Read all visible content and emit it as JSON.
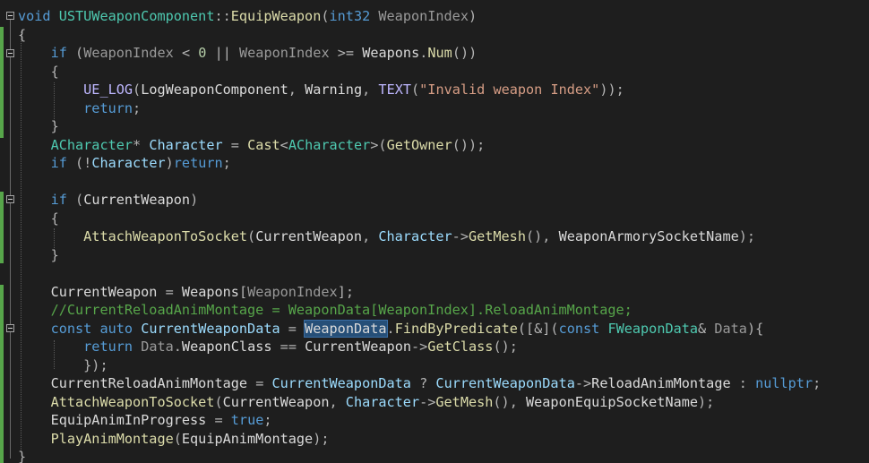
{
  "colors": {
    "background": "#1e1e1e",
    "keyword": "#569cd6",
    "type": "#4ec9b0",
    "function": "#dcdcaa",
    "macro": "#beb7ff",
    "string": "#d69d85",
    "comment": "#57a64a",
    "number": "#b5cea8",
    "parameter": "#9a9a9a",
    "local": "#9cdcfe",
    "change_bar": "#57a64a",
    "selection": "#264f78"
  },
  "editor": {
    "language": "C++",
    "fold_markers": [
      "line-1",
      "line-3",
      "line-11",
      "line-18"
    ],
    "highlighted_word": "WeaponData",
    "lines": [
      {
        "tokens": [
          {
            "k": "keyword",
            "t": "void"
          },
          {
            "k": "plain",
            "t": " "
          },
          {
            "k": "type",
            "t": "USTUWeaponComponent"
          },
          {
            "k": "op",
            "t": "::"
          },
          {
            "k": "func",
            "t": "EquipWeapon"
          },
          {
            "k": "op",
            "t": "("
          },
          {
            "k": "keyword",
            "t": "int32"
          },
          {
            "k": "plain",
            "t": " "
          },
          {
            "k": "param",
            "t": "WeaponIndex"
          },
          {
            "k": "op",
            "t": ")"
          }
        ]
      },
      {
        "tokens": [
          {
            "k": "op",
            "t": "{"
          }
        ]
      },
      {
        "tokens": [
          {
            "k": "plain",
            "t": "    "
          },
          {
            "k": "keyword",
            "t": "if"
          },
          {
            "k": "plain",
            "t": " "
          },
          {
            "k": "op",
            "t": "("
          },
          {
            "k": "param",
            "t": "WeaponIndex"
          },
          {
            "k": "plain",
            "t": " "
          },
          {
            "k": "op",
            "t": "<"
          },
          {
            "k": "plain",
            "t": " "
          },
          {
            "k": "number",
            "t": "0"
          },
          {
            "k": "plain",
            "t": " "
          },
          {
            "k": "op",
            "t": "||"
          },
          {
            "k": "plain",
            "t": " "
          },
          {
            "k": "param",
            "t": "WeaponIndex"
          },
          {
            "k": "plain",
            "t": " "
          },
          {
            "k": "op",
            "t": ">="
          },
          {
            "k": "plain",
            "t": " "
          },
          {
            "k": "member",
            "t": "Weapons"
          },
          {
            "k": "op",
            "t": "."
          },
          {
            "k": "func",
            "t": "Num"
          },
          {
            "k": "op",
            "t": "())"
          }
        ]
      },
      {
        "tokens": [
          {
            "k": "plain",
            "t": "    "
          },
          {
            "k": "op",
            "t": "{"
          }
        ]
      },
      {
        "tokens": [
          {
            "k": "plain",
            "t": "        "
          },
          {
            "k": "macro",
            "t": "UE_LOG"
          },
          {
            "k": "op",
            "t": "("
          },
          {
            "k": "plain",
            "t": "LogWeaponComponent"
          },
          {
            "k": "op",
            "t": ","
          },
          {
            "k": "plain",
            "t": " "
          },
          {
            "k": "plain",
            "t": "Warning"
          },
          {
            "k": "op",
            "t": ","
          },
          {
            "k": "plain",
            "t": " "
          },
          {
            "k": "macro",
            "t": "TEXT"
          },
          {
            "k": "op",
            "t": "("
          },
          {
            "k": "string",
            "t": "\"Invalid weapon Index\""
          },
          {
            "k": "op",
            "t": "));"
          }
        ]
      },
      {
        "tokens": [
          {
            "k": "plain",
            "t": "        "
          },
          {
            "k": "keyword",
            "t": "return"
          },
          {
            "k": "op",
            "t": ";"
          }
        ]
      },
      {
        "tokens": [
          {
            "k": "plain",
            "t": "    "
          },
          {
            "k": "op",
            "t": "}"
          }
        ]
      },
      {
        "tokens": [
          {
            "k": "plain",
            "t": "    "
          },
          {
            "k": "type",
            "t": "ACharacter"
          },
          {
            "k": "op",
            "t": "*"
          },
          {
            "k": "plain",
            "t": " "
          },
          {
            "k": "local",
            "t": "Character"
          },
          {
            "k": "plain",
            "t": " "
          },
          {
            "k": "op",
            "t": "="
          },
          {
            "k": "plain",
            "t": " "
          },
          {
            "k": "func",
            "t": "Cast"
          },
          {
            "k": "op",
            "t": "<"
          },
          {
            "k": "type",
            "t": "ACharacter"
          },
          {
            "k": "op",
            "t": ">("
          },
          {
            "k": "func",
            "t": "GetOwner"
          },
          {
            "k": "op",
            "t": "());"
          }
        ]
      },
      {
        "tokens": [
          {
            "k": "plain",
            "t": "    "
          },
          {
            "k": "keyword",
            "t": "if"
          },
          {
            "k": "plain",
            "t": " "
          },
          {
            "k": "op",
            "t": "(!"
          },
          {
            "k": "local",
            "t": "Character"
          },
          {
            "k": "op",
            "t": ")"
          },
          {
            "k": "keyword",
            "t": "return"
          },
          {
            "k": "op",
            "t": ";"
          }
        ]
      },
      {
        "tokens": [
          {
            "k": "plain",
            "t": ""
          }
        ]
      },
      {
        "tokens": [
          {
            "k": "plain",
            "t": "    "
          },
          {
            "k": "keyword",
            "t": "if"
          },
          {
            "k": "plain",
            "t": " "
          },
          {
            "k": "op",
            "t": "("
          },
          {
            "k": "member",
            "t": "CurrentWeapon"
          },
          {
            "k": "op",
            "t": ")"
          }
        ]
      },
      {
        "tokens": [
          {
            "k": "plain",
            "t": "    "
          },
          {
            "k": "op",
            "t": "{"
          }
        ]
      },
      {
        "tokens": [
          {
            "k": "plain",
            "t": "        "
          },
          {
            "k": "func",
            "t": "AttachWeaponToSocket"
          },
          {
            "k": "op",
            "t": "("
          },
          {
            "k": "member",
            "t": "CurrentWeapon"
          },
          {
            "k": "op",
            "t": ","
          },
          {
            "k": "plain",
            "t": " "
          },
          {
            "k": "local",
            "t": "Character"
          },
          {
            "k": "op",
            "t": "->"
          },
          {
            "k": "func",
            "t": "GetMesh"
          },
          {
            "k": "op",
            "t": "(),"
          },
          {
            "k": "plain",
            "t": " "
          },
          {
            "k": "member",
            "t": "WeaponArmorySocketName"
          },
          {
            "k": "op",
            "t": ");"
          }
        ]
      },
      {
        "tokens": [
          {
            "k": "plain",
            "t": "    "
          },
          {
            "k": "op",
            "t": "}"
          }
        ]
      },
      {
        "tokens": [
          {
            "k": "plain",
            "t": ""
          }
        ]
      },
      {
        "tokens": [
          {
            "k": "plain",
            "t": "    "
          },
          {
            "k": "member",
            "t": "CurrentWeapon"
          },
          {
            "k": "plain",
            "t": " "
          },
          {
            "k": "op",
            "t": "="
          },
          {
            "k": "plain",
            "t": " "
          },
          {
            "k": "member",
            "t": "Weapons"
          },
          {
            "k": "op",
            "t": "["
          },
          {
            "k": "param",
            "t": "WeaponIndex"
          },
          {
            "k": "op",
            "t": "];"
          }
        ]
      },
      {
        "tokens": [
          {
            "k": "plain",
            "t": "    "
          },
          {
            "k": "comment",
            "t": "//CurrentReloadAnimMontage = WeaponData[WeaponIndex].ReloadAnimMontage;"
          }
        ]
      },
      {
        "tokens": [
          {
            "k": "plain",
            "t": "    "
          },
          {
            "k": "keyword",
            "t": "const"
          },
          {
            "k": "plain",
            "t": " "
          },
          {
            "k": "keyword",
            "t": "auto"
          },
          {
            "k": "plain",
            "t": " "
          },
          {
            "k": "local",
            "t": "CurrentWeaponData"
          },
          {
            "k": "plain",
            "t": " "
          },
          {
            "k": "op",
            "t": "="
          },
          {
            "k": "plain",
            "t": " "
          },
          {
            "k": "member",
            "t": "WeaponData",
            "h": true
          },
          {
            "k": "op",
            "t": "."
          },
          {
            "k": "func",
            "t": "FindByPredicate"
          },
          {
            "k": "op",
            "t": "([&]("
          },
          {
            "k": "keyword",
            "t": "const"
          },
          {
            "k": "plain",
            "t": " "
          },
          {
            "k": "type",
            "t": "FWeaponData"
          },
          {
            "k": "op",
            "t": "&"
          },
          {
            "k": "plain",
            "t": " "
          },
          {
            "k": "param",
            "t": "Data"
          },
          {
            "k": "op",
            "t": "){"
          }
        ]
      },
      {
        "tokens": [
          {
            "k": "plain",
            "t": "        "
          },
          {
            "k": "keyword",
            "t": "return"
          },
          {
            "k": "plain",
            "t": " "
          },
          {
            "k": "param",
            "t": "Data"
          },
          {
            "k": "op",
            "t": "."
          },
          {
            "k": "plain",
            "t": "WeaponClass"
          },
          {
            "k": "plain",
            "t": " "
          },
          {
            "k": "op",
            "t": "=="
          },
          {
            "k": "plain",
            "t": " "
          },
          {
            "k": "member",
            "t": "CurrentWeapon"
          },
          {
            "k": "op",
            "t": "->"
          },
          {
            "k": "func",
            "t": "GetClass"
          },
          {
            "k": "op",
            "t": "();"
          }
        ]
      },
      {
        "tokens": [
          {
            "k": "plain",
            "t": "        "
          },
          {
            "k": "op",
            "t": "});"
          }
        ]
      },
      {
        "tokens": [
          {
            "k": "plain",
            "t": "    "
          },
          {
            "k": "member",
            "t": "CurrentReloadAnimMontage"
          },
          {
            "k": "plain",
            "t": " "
          },
          {
            "k": "op",
            "t": "="
          },
          {
            "k": "plain",
            "t": " "
          },
          {
            "k": "local",
            "t": "CurrentWeaponData"
          },
          {
            "k": "plain",
            "t": " "
          },
          {
            "k": "op",
            "t": "?"
          },
          {
            "k": "plain",
            "t": " "
          },
          {
            "k": "local",
            "t": "CurrentWeaponData"
          },
          {
            "k": "op",
            "t": "->"
          },
          {
            "k": "plain",
            "t": "ReloadAnimMontage"
          },
          {
            "k": "plain",
            "t": " "
          },
          {
            "k": "op",
            "t": ":"
          },
          {
            "k": "plain",
            "t": " "
          },
          {
            "k": "keyword",
            "t": "nullptr"
          },
          {
            "k": "op",
            "t": ";"
          }
        ]
      },
      {
        "tokens": [
          {
            "k": "plain",
            "t": "    "
          },
          {
            "k": "func",
            "t": "AttachWeaponToSocket"
          },
          {
            "k": "op",
            "t": "("
          },
          {
            "k": "member",
            "t": "CurrentWeapon"
          },
          {
            "k": "op",
            "t": ","
          },
          {
            "k": "plain",
            "t": " "
          },
          {
            "k": "local",
            "t": "Character"
          },
          {
            "k": "op",
            "t": "->"
          },
          {
            "k": "func",
            "t": "GetMesh"
          },
          {
            "k": "op",
            "t": "(),"
          },
          {
            "k": "plain",
            "t": " "
          },
          {
            "k": "member",
            "t": "WeaponEquipSocketName"
          },
          {
            "k": "op",
            "t": ");"
          }
        ]
      },
      {
        "tokens": [
          {
            "k": "plain",
            "t": "    "
          },
          {
            "k": "member",
            "t": "EquipAnimInProgress"
          },
          {
            "k": "plain",
            "t": " "
          },
          {
            "k": "op",
            "t": "="
          },
          {
            "k": "plain",
            "t": " "
          },
          {
            "k": "keyword",
            "t": "true"
          },
          {
            "k": "op",
            "t": ";"
          }
        ]
      },
      {
        "tokens": [
          {
            "k": "plain",
            "t": "    "
          },
          {
            "k": "func",
            "t": "PlayAnimMontage"
          },
          {
            "k": "op",
            "t": "("
          },
          {
            "k": "member",
            "t": "EquipAnimMontage"
          },
          {
            "k": "op",
            "t": ");"
          }
        ]
      },
      {
        "tokens": [
          {
            "k": "op",
            "t": "}"
          }
        ]
      }
    ]
  }
}
